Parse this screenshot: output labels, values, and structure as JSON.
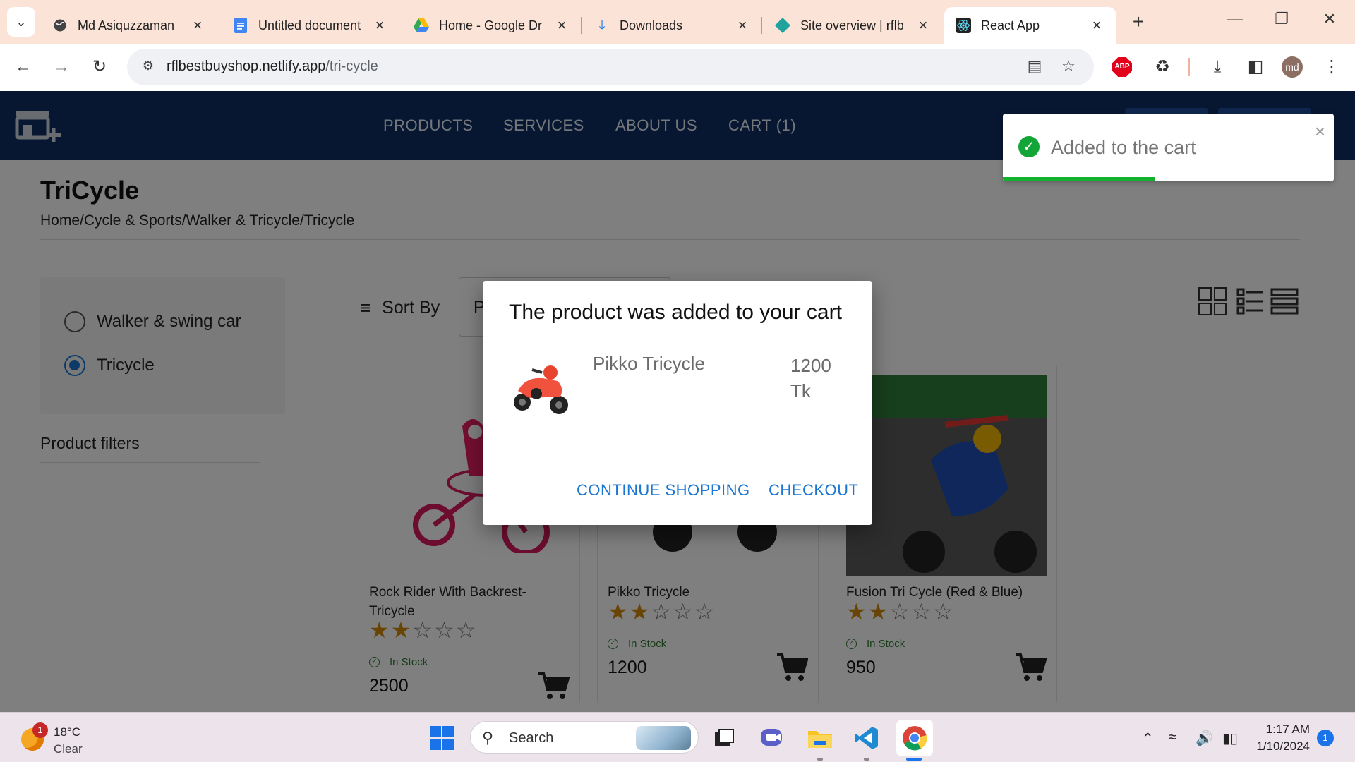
{
  "browser": {
    "tabs": [
      {
        "title": "Md Asiquzzaman",
        "icon": "globe-icon"
      },
      {
        "title": "Untitled document",
        "icon": "google-docs-icon"
      },
      {
        "title": "Home - Google Dr",
        "icon": "google-drive-icon"
      },
      {
        "title": "Downloads",
        "icon": "download-icon"
      },
      {
        "title": "Site overview | rflb",
        "icon": "netlify-icon"
      },
      {
        "title": "React App",
        "icon": "react-icon",
        "active": true
      }
    ],
    "url_host": "rflbestbuyshop.netlify.app",
    "url_path": "/tri-cycle",
    "profile_initials": "md",
    "abp_label": "ABP"
  },
  "site": {
    "nav": [
      "PRODUCTS",
      "SERVICES",
      "ABOUT US",
      "CART (1)"
    ],
    "page_title": "TriCycle",
    "breadcrumb": "Home/Cycle & Sports/Walker & Tricycle/Tricycle",
    "categories": [
      {
        "label": "Walker & swing car",
        "selected": false
      },
      {
        "label": "Tricycle",
        "selected": true
      }
    ],
    "filters_label": "Product filters",
    "sort_label": "Sort By",
    "sort_value": "P",
    "colors": {
      "header": "#0f2f63",
      "accent": "#1976d2",
      "star": "#d08a0a",
      "stock": "#2e7d32",
      "toast_success": "#13a538"
    }
  },
  "products": [
    {
      "name": "Rock Rider With Backrest-Tricycle",
      "rating": 2,
      "max_rating": 5,
      "stock": "In Stock",
      "price": "2500"
    },
    {
      "name": "Pikko Tricycle",
      "rating": 2,
      "max_rating": 5,
      "stock": "In Stock",
      "price": "1200"
    },
    {
      "name": "Fusion Tri Cycle (Red & Blue)",
      "rating": 2,
      "max_rating": 5,
      "stock": "In Stock",
      "price": "950"
    }
  ],
  "dialog": {
    "title": "The product was added to your cart",
    "product_name": "Pikko Tricycle",
    "product_price": "1200 Tk",
    "continue_label": "CONTINUE SHOPPING",
    "checkout_label": "CHECKOUT"
  },
  "toast": {
    "message": "Added to the cart",
    "progress": 0.46
  },
  "taskbar": {
    "temperature": "18°C",
    "condition": "Clear",
    "weather_badge": "1",
    "search_placeholder": "Search",
    "time": "1:17 AM",
    "date": "1/10/2024",
    "notifications": "1"
  }
}
